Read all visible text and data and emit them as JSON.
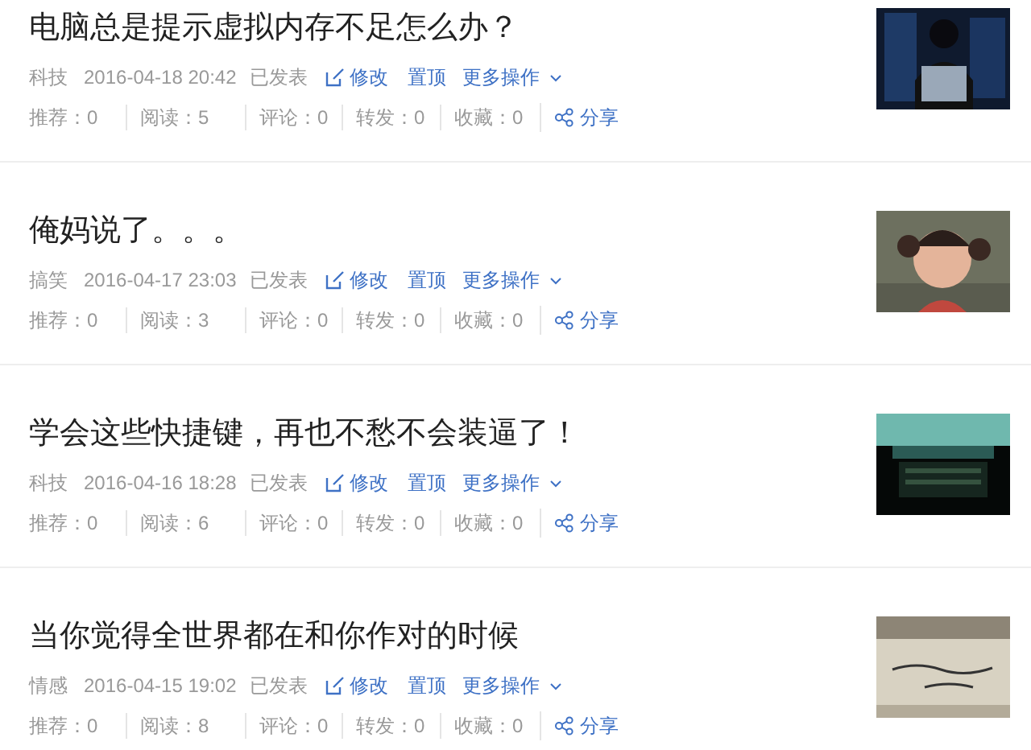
{
  "articles": [
    {
      "title": "电脑总是提示虚拟内存不足怎么办？",
      "category": "科技",
      "date": "2016-04-18 20:42",
      "status": "已发表",
      "edit": "修改",
      "pin": "置顶",
      "more": "更多操作",
      "stats": [
        "推荐：0",
        "阅读：5",
        "评论：0",
        "转发：0",
        "收藏：0"
      ],
      "share": "分享"
    },
    {
      "title": "俺妈说了。。。",
      "category": "搞笑",
      "date": "2016-04-17 23:03",
      "status": "已发表",
      "edit": "修改",
      "pin": "置顶",
      "more": "更多操作",
      "stats": [
        "推荐：0",
        "阅读：3",
        "评论：0",
        "转发：0",
        "收藏：0"
      ],
      "share": "分享"
    },
    {
      "title": "学会这些快捷键，再也不愁不会装逼了！",
      "category": "科技",
      "date": "2016-04-16 18:28",
      "status": "已发表",
      "edit": "修改",
      "pin": "置顶",
      "more": "更多操作",
      "stats": [
        "推荐：0",
        "阅读：6",
        "评论：0",
        "转发：0",
        "收藏：0"
      ],
      "share": "分享"
    },
    {
      "title": "当你觉得全世界都在和你作对的时候",
      "category": "情感",
      "date": "2016-04-15 19:02",
      "status": "已发表",
      "edit": "修改",
      "pin": "置顶",
      "more": "更多操作",
      "stats": [
        "推荐：0",
        "阅读：8",
        "评论：0",
        "转发：0",
        "收藏：0"
      ],
      "share": "分享"
    }
  ]
}
